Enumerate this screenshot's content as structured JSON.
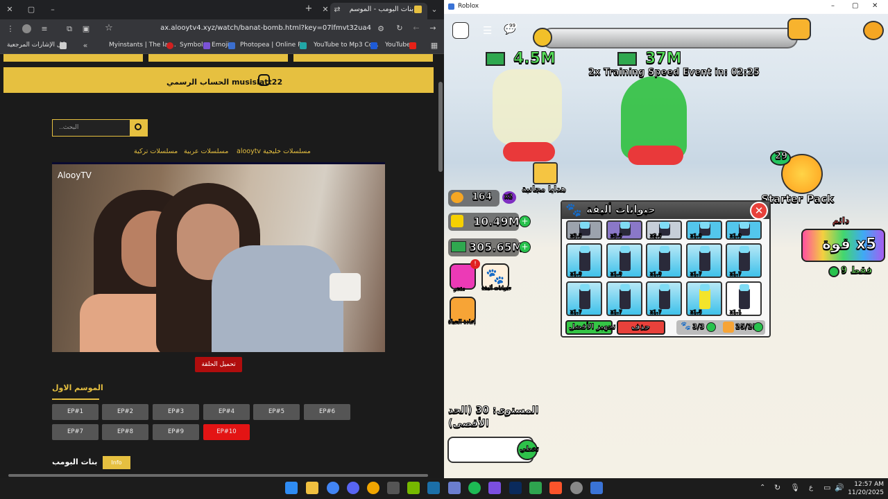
{
  "browser": {
    "tab_title": "بنات البومب - الموسم الاول",
    "url": "ax.alooytv4.xyz/watch/banat-bomb.html?key=07lfmvt32ua4",
    "bookmarks": {
      "all_bookmarks": "كل الإشارات المرجعية",
      "items": [
        "Myinstants | The lar...",
        "Symbols",
        "Emoji",
        "Photopea | Online P...",
        "YouTube to Mp3 Co...",
        "YouTube"
      ]
    },
    "site": {
      "instagram_label": "الحساب الرسمي musislatt22",
      "search_placeholder": "..البحث",
      "categories": [
        "alooytv مسلسلات خليجية",
        "مسلسلات عربية",
        "مسلسلات تركية"
      ],
      "video_watermark": "AlooyTV",
      "download_label": "تحميل الحلقة",
      "season_title": "الموسم الاول",
      "episodes": [
        "EP#1",
        "EP#2",
        "EP#3",
        "EP#4",
        "EP#5",
        "EP#6",
        "EP#7",
        "EP#8",
        "EP#9",
        "EP#10"
      ],
      "active_episode": "EP#10",
      "series_title": "بنات البومب",
      "info_badge": "Info"
    }
  },
  "roblox": {
    "window_title": "Roblox",
    "chat_badge": "99",
    "top_cash_1": "4.5M",
    "top_cash_2": "37M",
    "event_text": "2x Training Speed Event in: 02:25",
    "free_gifts": "هدايا مجانية",
    "starter_pack": "Starter Pack",
    "starter_badge": "29",
    "stat_strength": "164",
    "stat_mult": "x2",
    "stat_energy": "10.49M",
    "stat_cash": "305.65M",
    "shop_label": "متجر",
    "pets_side_label": "حيوانات أليفة",
    "rebirth_label": "إعادة الحياة",
    "pets_panel_title": "حيوانات أليفة",
    "pets_top_row": [
      "x3.5",
      "x3.5",
      "x2.5",
      "x1.9",
      "x1.9"
    ],
    "pets_row2": [
      "x1.9",
      "x1.9",
      "x1.9",
      "x1.7",
      "x1.7"
    ],
    "pets_row3": [
      "x1.7",
      "x1.7",
      "x1.7",
      "x1.5",
      "x1.1"
    ],
    "equip_best": "تجهيز الأفضل",
    "delete_label": "حذف",
    "equipped_count": "3/3",
    "storage_count": "25/25",
    "permanent": "دائم",
    "power_offer": "قوة x5",
    "only_price": "فقط 9",
    "level_text": "المستوى: 30 (الحد الأقصى)",
    "skip_label": "تخطي"
  },
  "taskbar": {
    "time": "12:57 AM",
    "date": "11/20/2025",
    "lang": "ع"
  },
  "colors": {
    "site_accent": "#e6c040",
    "episode_active": "#e31414",
    "download_red": "#b00d0d"
  }
}
